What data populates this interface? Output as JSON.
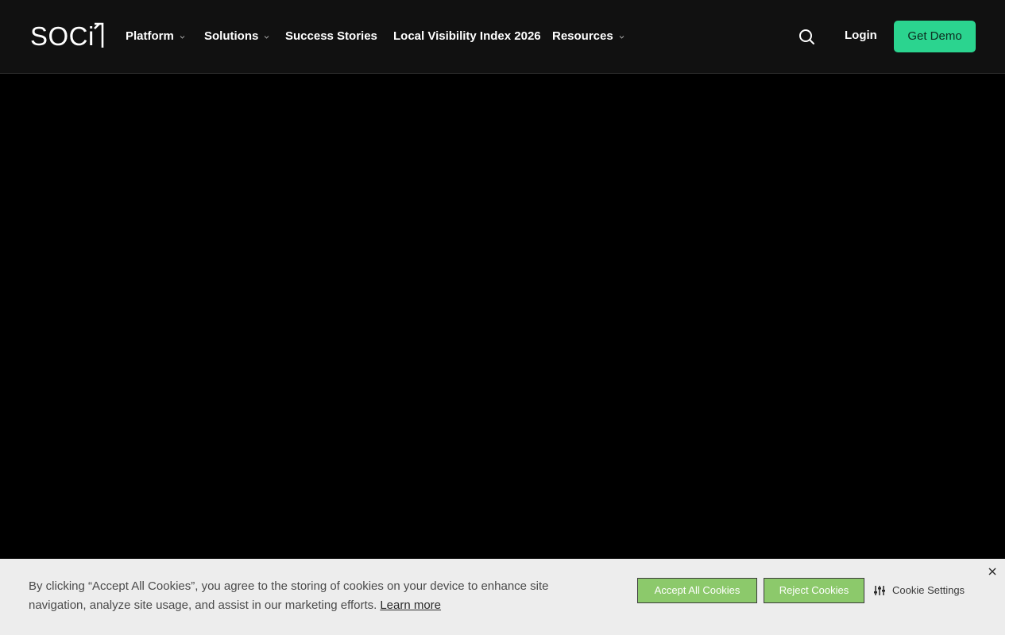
{
  "header": {
    "logo_text": "SOCi",
    "nav": [
      {
        "label": "Platform",
        "has_dropdown": true
      },
      {
        "label": "Solutions",
        "has_dropdown": true
      },
      {
        "label": "Success Stories",
        "has_dropdown": false
      },
      {
        "label": "Local Visibility Index 2026",
        "has_dropdown": false
      },
      {
        "label": "Resources",
        "has_dropdown": true
      }
    ],
    "search_icon": "search-icon",
    "login_label": "Login",
    "demo_label": "Get Demo"
  },
  "cookie_banner": {
    "text": "By clicking “Accept All Cookies”, you agree to the storing of cookies on your device to enhance site navigation, analyze site usage, and assist in our marketing efforts.",
    "learn_more": "Learn more",
    "accept_label": "Accept All Cookies",
    "reject_label": "Reject Cookies",
    "settings_label": "Cookie Settings",
    "settings_icon": "sliders-icon",
    "close_icon": "close-icon"
  },
  "colors": {
    "header_bg": "#111111",
    "accent_green": "#2bd48f",
    "cookie_button_green": "#8cc96b",
    "banner_bg": "#ededed"
  }
}
